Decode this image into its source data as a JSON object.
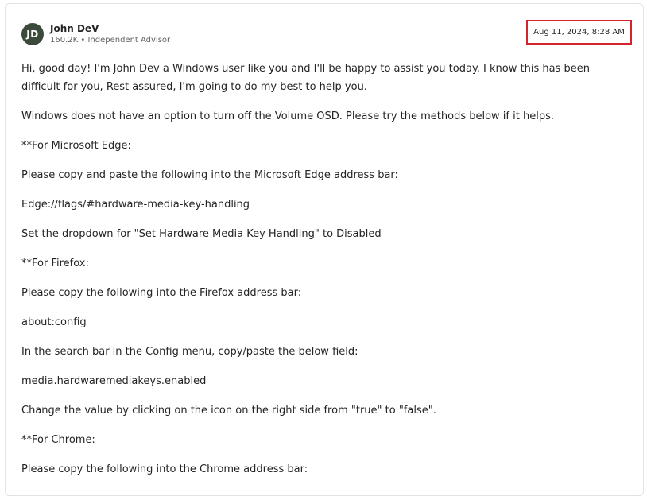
{
  "post": {
    "author": {
      "initials": "JD",
      "name": "John DeV",
      "meta": "160.2K • Independent Advisor",
      "avatar_color": "#3b4a3a"
    },
    "timestamp": "Aug 11, 2024, 8:28 AM",
    "highlight_color": "#d3232c",
    "paragraphs": [
      "Hi, good day! I'm John Dev a Windows user like you and I'll be happy to assist you today. I know this has been difficult for you, Rest assured, I'm going to do my best to help you.",
      "Windows does not have an option to turn off the Volume OSD. Please try the methods below if it helps.",
      "**For Microsoft Edge:",
      "Please copy and paste the following into the Microsoft Edge address bar:",
      "Edge://flags/#hardware-media-key-handling",
      "Set the dropdown for \"Set Hardware Media Key Handling\" to Disabled",
      "**For Firefox:",
      "Please copy the following into the Firefox address bar:",
      "about:config",
      "In the search bar in the Config menu, copy/paste the below field:",
      "media.hardwaremediakeys.enabled",
      "Change the value by clicking on the icon on the right side from \"true\" to \"false\".",
      "**For Chrome:",
      "Please copy the following into the Chrome address bar:"
    ]
  }
}
